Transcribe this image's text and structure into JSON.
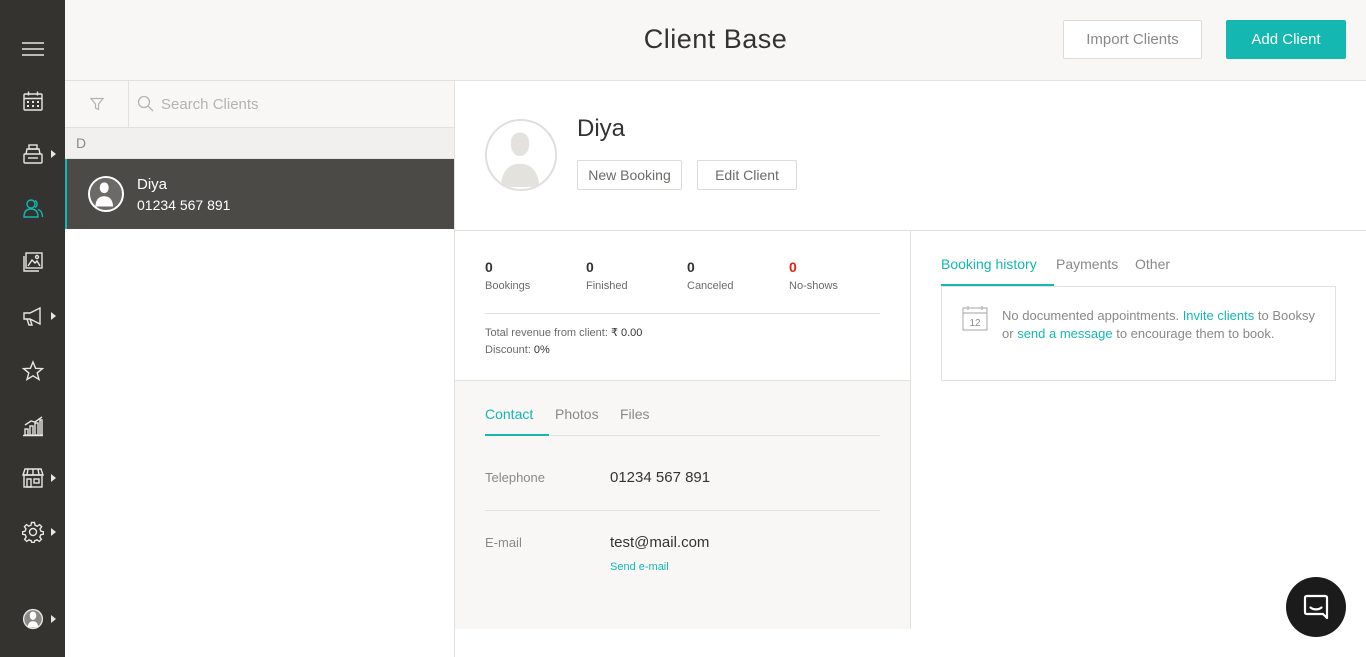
{
  "colors": {
    "accent": "#14b8b0",
    "sidebar": "#343330",
    "danger": "#e0220f"
  },
  "sidebar": {
    "items": [
      {
        "name": "menu-icon",
        "caret": false
      },
      {
        "name": "calendar-icon",
        "caret": false
      },
      {
        "name": "cash-register-icon",
        "caret": true
      },
      {
        "name": "clients-icon",
        "caret": false,
        "active": true
      },
      {
        "name": "gallery-icon",
        "caret": false
      },
      {
        "name": "megaphone-icon",
        "caret": true
      },
      {
        "name": "star-icon",
        "caret": false
      },
      {
        "name": "stats-icon",
        "caret": false
      },
      {
        "name": "store-icon",
        "caret": true
      },
      {
        "name": "settings-icon",
        "caret": true
      },
      {
        "name": "profile-icon",
        "caret": true
      }
    ]
  },
  "header": {
    "title": "Client Base",
    "import_label": "Import Clients",
    "add_label": "Add Client"
  },
  "search": {
    "placeholder": "Search Clients",
    "value": ""
  },
  "client_list": {
    "group_letter": "D",
    "clients": [
      {
        "name": "Diya",
        "phone": "01234 567 891"
      }
    ]
  },
  "client": {
    "name": "Diya",
    "new_booking_label": "New Booking",
    "edit_label": "Edit Client",
    "stats": [
      {
        "value": "0",
        "label": "Bookings"
      },
      {
        "value": "0",
        "label": "Finished"
      },
      {
        "value": "0",
        "label": "Canceled"
      },
      {
        "value": "0",
        "label": "No-shows"
      }
    ],
    "revenue_label": "Total revenue from client:",
    "revenue_value": "₹ 0.00",
    "discount_label": "Discount:",
    "discount_value": "0%",
    "contact_tabs": [
      "Contact",
      "Photos",
      "Files"
    ],
    "telephone_label": "Telephone",
    "telephone_value": "01234 567 891",
    "email_label": "E-mail",
    "email_value": "test@mail.com",
    "send_email_label": "Send e-mail",
    "history_tabs": [
      "Booking history",
      "Payments",
      "Other"
    ],
    "history_empty": {
      "calendar_day": "12",
      "text_1": "No documented appointments.",
      "link_1": "Invite clients",
      "text_2": "to Booksy or",
      "link_2": "send a message",
      "text_3": "to encourage them to book."
    }
  }
}
